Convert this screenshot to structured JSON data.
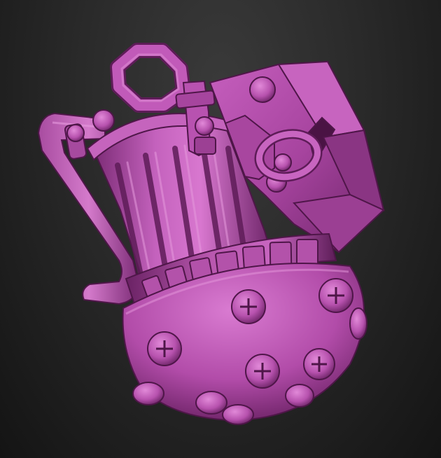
{
  "scene": {
    "subject": "grenade-model",
    "colors": {
      "background_top": "#3a3a3a",
      "background_bottom": "#141414",
      "matcap_light": "#e07ad6",
      "matcap_mid": "#b94fb2",
      "matcap_dark": "#6e2168",
      "matcap_shadow": "#3e1039"
    },
    "parts": [
      "octagonal-ring-loop",
      "top-clamp",
      "fluted-canister",
      "side-lever-handle",
      "trigger-box",
      "pull-ring",
      "segmented-band",
      "domed-base",
      "cross-bolts"
    ]
  }
}
